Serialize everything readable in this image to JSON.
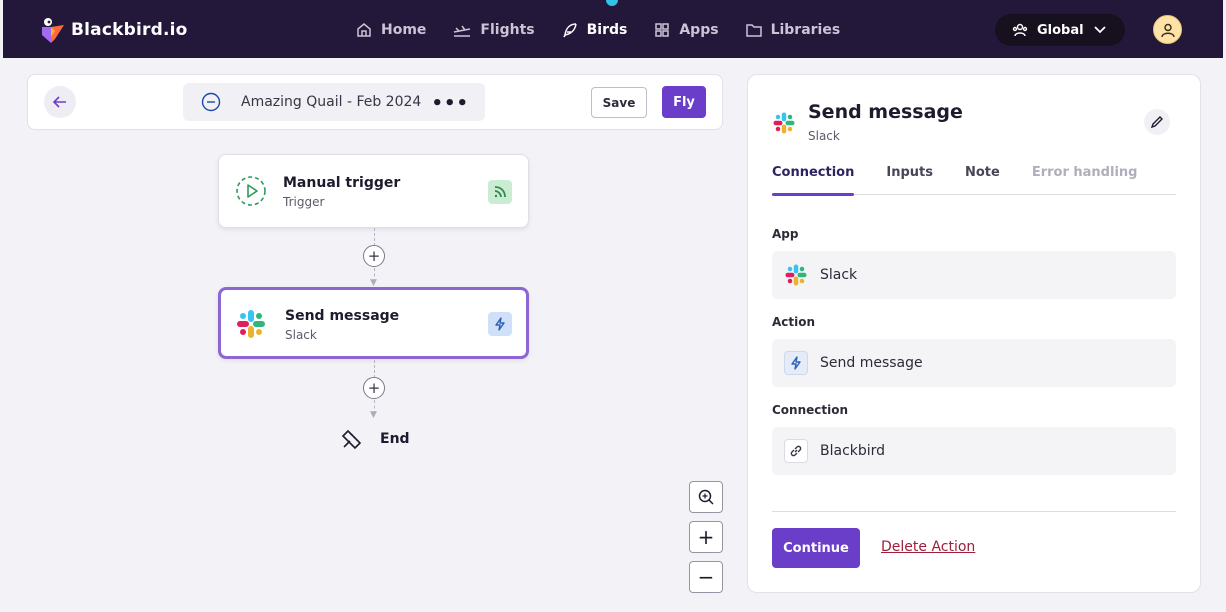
{
  "app": {
    "name": "Blackbird.io"
  },
  "nav": {
    "items": [
      {
        "label": "Home",
        "icon": "home-icon"
      },
      {
        "label": "Flights",
        "icon": "flights-icon"
      },
      {
        "label": "Birds",
        "icon": "feather-icon",
        "active": true
      },
      {
        "label": "Apps",
        "icon": "grid-icon"
      },
      {
        "label": "Libraries",
        "icon": "folder-icon"
      }
    ]
  },
  "environment": {
    "label": "Global"
  },
  "flow": {
    "name": "Amazing Quail - Feb 2024",
    "save_label": "Save",
    "fly_label": "Fly"
  },
  "canvas": {
    "trigger": {
      "title": "Manual trigger",
      "subtitle": "Trigger"
    },
    "action": {
      "title": "Send message",
      "subtitle": "Slack"
    },
    "end_label": "End",
    "add_symbol": "+",
    "zoom_in": "+",
    "zoom_out": "−"
  },
  "panel": {
    "title": "Send message",
    "subtitle": "Slack",
    "tabs": [
      "Connection",
      "Inputs",
      "Note",
      "Error handling"
    ],
    "active_tab": "Connection",
    "disabled_tab": "Error handling",
    "fields": {
      "app": {
        "label": "App",
        "value": "Slack"
      },
      "action": {
        "label": "Action",
        "value": "Send message"
      },
      "connection": {
        "label": "Connection",
        "value": "Blackbird"
      }
    },
    "continue_label": "Continue",
    "delete_label": "Delete Action"
  },
  "colors": {
    "topbar": "#24183a",
    "accent": "#6a3ec8",
    "danger": "#9d1f3b"
  }
}
